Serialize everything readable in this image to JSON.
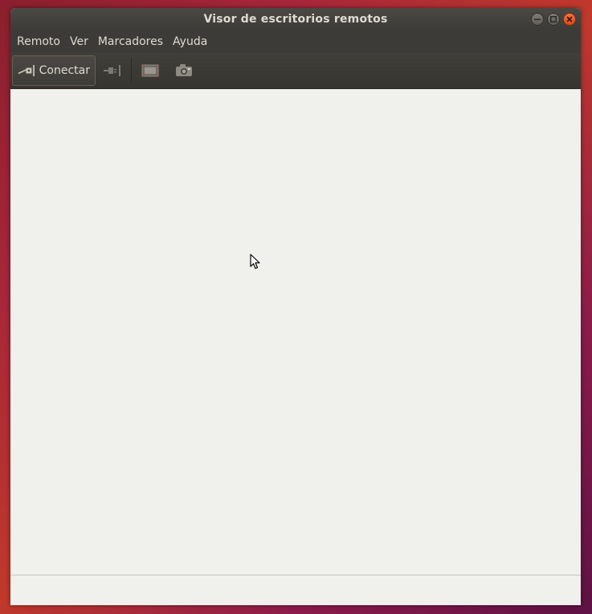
{
  "window": {
    "title": "Visor de escritorios remotos"
  },
  "menubar": {
    "items": [
      {
        "label": "Remoto"
      },
      {
        "label": "Ver"
      },
      {
        "label": "Marcadores"
      },
      {
        "label": "Ayuda"
      }
    ]
  },
  "toolbar": {
    "connect_label": "Conectar",
    "icons": [
      "connect-icon",
      "disconnect-icon",
      "fullscreen-icon",
      "screenshot-icon"
    ]
  },
  "statusbar": {
    "text": ""
  },
  "colors": {
    "titlebar": "#3c3b37",
    "content_bg": "#f0f0ec",
    "close_button": "#df4b16"
  }
}
